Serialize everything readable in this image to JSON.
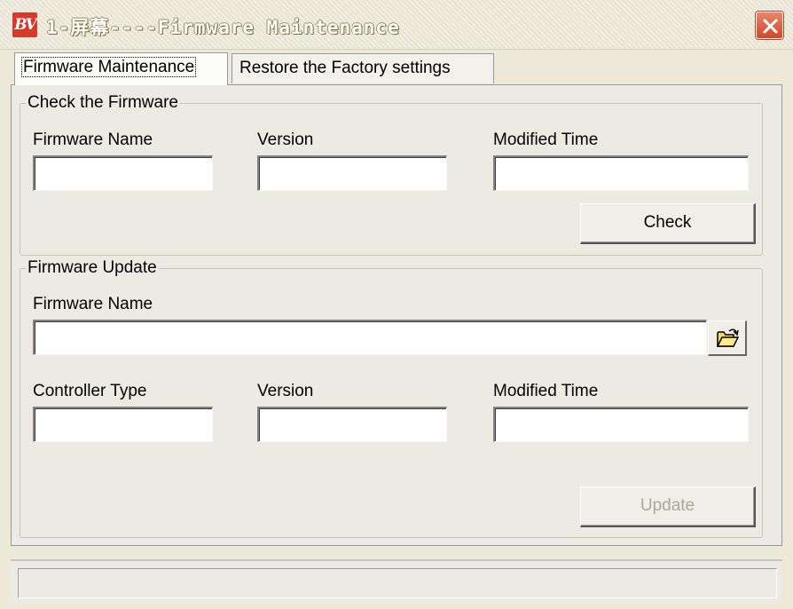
{
  "window": {
    "title": "1-屏幕----Firmware Maintenance",
    "app_icon_text": "BV"
  },
  "tabs": [
    {
      "label": "Firmware Maintenance",
      "active": true
    },
    {
      "label": "Restore the Factory settings",
      "active": false
    }
  ],
  "check_group": {
    "legend": "Check the Firmware",
    "firmware_name_label": "Firmware Name",
    "firmware_name_value": "",
    "version_label": "Version",
    "version_value": "",
    "modified_time_label": "Modified Time",
    "modified_time_value": "",
    "check_button": "Check"
  },
  "update_group": {
    "legend": "Firmware Update",
    "firmware_name_label": "Firmware Name",
    "firmware_path_value": "",
    "browse_icon": "folder-open-icon",
    "controller_type_label": "Controller Type",
    "controller_type_value": "",
    "version_label": "Version",
    "version_value": "",
    "modified_time_label": "Modified Time",
    "modified_time_value": "",
    "update_button": "Update",
    "update_enabled": false
  },
  "status": {
    "text": ""
  },
  "colors": {
    "background": "#ece9d8",
    "close_button": "#d2462a",
    "disabled_text": "#aca899"
  }
}
